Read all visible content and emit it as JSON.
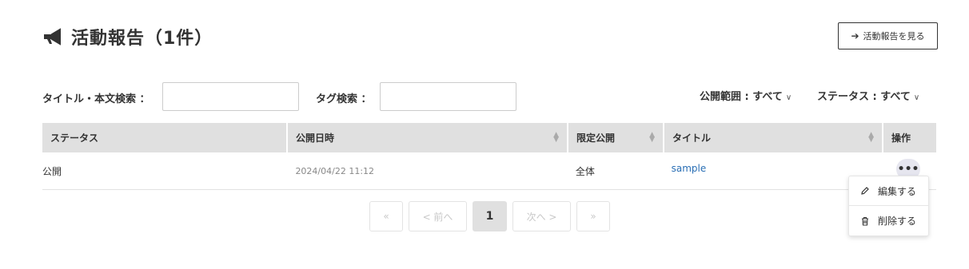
{
  "header": {
    "title": "活動報告（1件）",
    "view_button": "活動報告を見る"
  },
  "filters": {
    "title_search_label": "タイトル・本文検索 ：",
    "title_search_value": "",
    "tag_search_label": "タグ検索 ：",
    "tag_search_value": "",
    "visibility_dropdown": "公開範囲 : すべて",
    "status_dropdown": "ステータス : すべて"
  },
  "table": {
    "columns": [
      "ステータス",
      "公開日時",
      "限定公開",
      "タイトル",
      "操作"
    ],
    "rows": [
      {
        "status": "公開",
        "published_at": "2024/04/22 11:12",
        "restricted": "全体",
        "title": "sample"
      }
    ]
  },
  "pagination": {
    "first": "«",
    "prev": "< 前へ",
    "current": "1",
    "next": "次へ >",
    "last": "»"
  },
  "row_menu": {
    "edit": "編集する",
    "delete": "削除する"
  },
  "icons": [
    "megaphone-icon",
    "arrow-right-icon",
    "chevron-down-icon",
    "sort-icon",
    "more-icon",
    "pencil-icon",
    "trash-icon"
  ]
}
